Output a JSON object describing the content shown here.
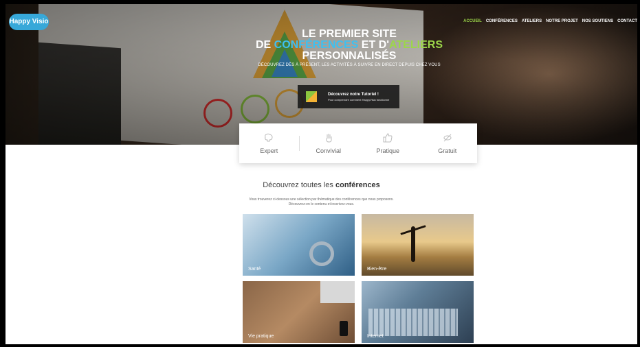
{
  "logo": {
    "text": "Happy Visio"
  },
  "nav": [
    {
      "label": "ACCUEIL",
      "active": true
    },
    {
      "label": "CONFÉRENCES",
      "active": false
    },
    {
      "label": "ATELIERS",
      "active": false
    },
    {
      "label": "NOTRE PROJET",
      "active": false
    },
    {
      "label": "NOS SOUTIENS",
      "active": false
    },
    {
      "label": "CONTACT",
      "active": false
    }
  ],
  "hero": {
    "line1": "LE PREMIER SITE",
    "line2_a": "DE ",
    "line2_b": "CONFÉRENCES",
    "line2_c": " ET D'",
    "line2_d": "ATELIERS",
    "line2_e": " PERSONNALISÉS",
    "sub": "DÉCOUVREZ DÈS À PRÉSENT, LES ACTIVITÉS À SUIVRE EN DIRECT DEPUIS CHEZ VOUS"
  },
  "tutorial": {
    "title": "Découvrez notre Tutoriel !",
    "subtitle": "Pour comprendre comment HappyVisio fonctionne"
  },
  "features": [
    {
      "label": "Expert",
      "icon": "brain-icon"
    },
    {
      "label": "Convivial",
      "icon": "hand-icon"
    },
    {
      "label": "Pratique",
      "icon": "thumbs-up-icon"
    },
    {
      "label": "Gratuit",
      "icon": "no-money-icon"
    }
  ],
  "section": {
    "title_prefix": "Découvrez toutes les ",
    "title_bold": "conférences",
    "intro_1": "Vous trouverez ci-dessous une sélection par thématique des conférences que nous proposons.",
    "intro_2": "Découvrez-en le contenu et inscrivez-vous."
  },
  "categories": [
    {
      "label": "Santé"
    },
    {
      "label": "Bien-être"
    },
    {
      "label": "Vie pratique"
    },
    {
      "label": "Internet"
    }
  ],
  "colors": {
    "accent_blue": "#3ec0f0",
    "accent_green": "#9cd64a"
  }
}
